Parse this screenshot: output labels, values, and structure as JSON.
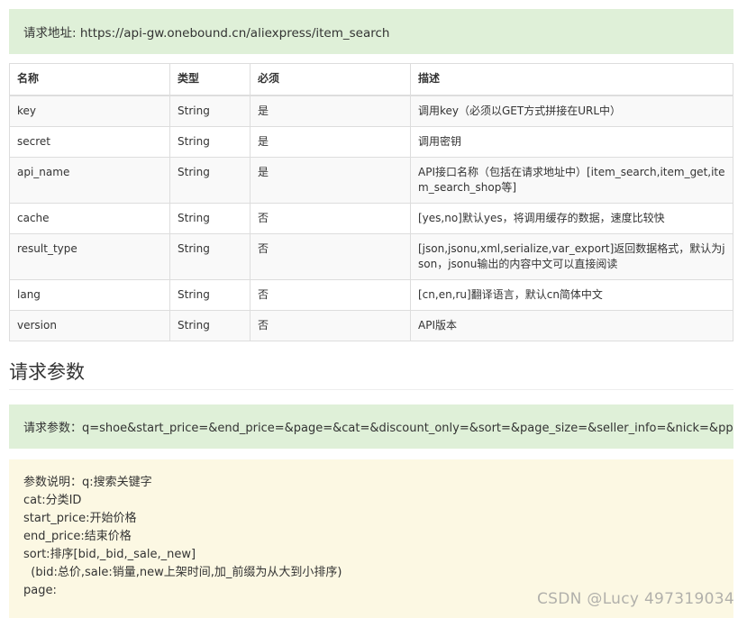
{
  "request_url": "请求地址: https://api-gw.onebound.cn/aliexpress/item_search",
  "table": {
    "headers": [
      "名称",
      "类型",
      "必须",
      "描述"
    ],
    "rows": [
      [
        "key",
        "String",
        "是",
        "调用key（必须以GET方式拼接在URL中）"
      ],
      [
        "secret",
        "String",
        "是",
        "调用密钥"
      ],
      [
        "api_name",
        "String",
        "是",
        "API接口名称（包括在请求地址中）[item_search,item_get,item_search_shop等]"
      ],
      [
        "cache",
        "String",
        "否",
        "[yes,no]默认yes，将调用缓存的数据，速度比较快"
      ],
      [
        "result_type",
        "String",
        "否",
        "[json,jsonu,xml,serialize,var_export]返回数据格式，默认为json，jsonu输出的内容中文可以直接阅读"
      ],
      [
        "lang",
        "String",
        "否",
        "[cn,en,ru]翻译语言，默认cn简体中文"
      ],
      [
        "version",
        "String",
        "否",
        "API版本"
      ]
    ]
  },
  "section_heading": "请求参数",
  "query_params": "请求参数：q=shoe&start_price=&end_price=&page=&cat=&discount_only=&sort=&page_size=&seller_info=&nick=&ppath=",
  "param_description": [
    "参数说明：q:搜索关键字",
    "cat:分类ID",
    "start_price:开始价格",
    "end_price:结束价格",
    "sort:排序[bid,_bid,_sale,_new]",
    "  (bid:总价,sale:销量,new上架时间,加_前缀为从大到小排序)",
    "page:"
  ],
  "watermark": "CSDN @Lucy 497319034"
}
